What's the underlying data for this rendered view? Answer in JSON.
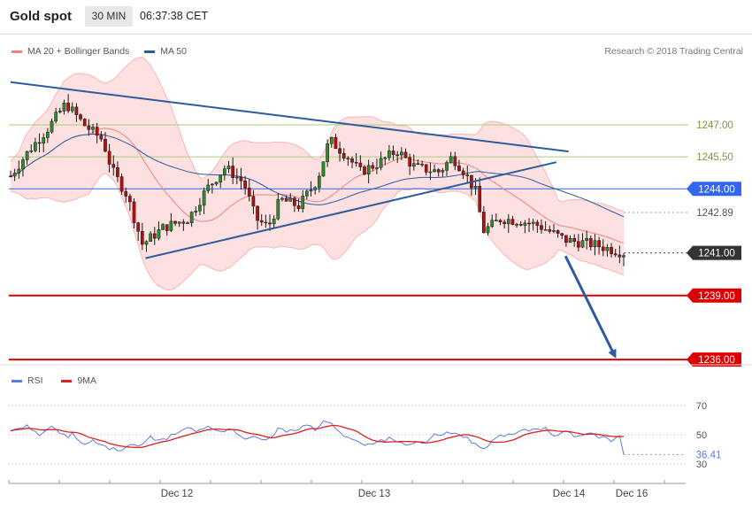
{
  "header": {
    "title": "Gold spot",
    "timeframe": "30 MIN",
    "time": "06:37:38 CET"
  },
  "legend": {
    "main": [
      {
        "label": "MA 20 + Bollinger Bands",
        "color": "#f08080"
      },
      {
        "label": "MA 50",
        "color": "#2e5a9e"
      }
    ],
    "rsi": [
      {
        "label": "RSI",
        "color": "#5b7be0"
      },
      {
        "label": "9MA",
        "color": "#e02020"
      }
    ]
  },
  "credit": "Research © 2018 Trading Central",
  "chart_data": [
    {
      "type": "candlestick",
      "ylim": [
        1235.5,
        1250.5
      ],
      "x_ticks": [
        "Dec 12",
        "Dec 13",
        "Dec 14",
        "Dec 16"
      ],
      "levels": [
        {
          "value": 1247.0,
          "label": "1247.00",
          "color": "#a8cf7a",
          "style": "solid"
        },
        {
          "value": 1245.5,
          "label": "1245.50",
          "color": "#a8cf7a",
          "style": "solid"
        },
        {
          "value": 1244.0,
          "label": "1244.00",
          "color": "#3366ee",
          "style": "solid",
          "tag_fill": "#3366ee"
        },
        {
          "value": 1242.89,
          "label": "1242.89",
          "color": "#8aa0d0",
          "style": "dotted"
        },
        {
          "value": 1241.0,
          "label": "1241.00",
          "color": "#444444",
          "style": "dotted",
          "tag_fill": "#333333"
        },
        {
          "value": 1239.0,
          "label": "1239.00",
          "color": "#dd0000",
          "style": "solid",
          "tag_fill": "#dd0000"
        },
        {
          "value": 1236.0,
          "label": "1236.00",
          "color": "#dd0000",
          "style": "solid",
          "tag_fill": "#dd0000"
        }
      ],
      "trendlines": [
        {
          "from": [
            0.0,
            1249.0
          ],
          "to": [
            0.91,
            1245.75
          ]
        },
        {
          "from": [
            0.22,
            1240.75
          ],
          "to": [
            0.89,
            1245.25
          ]
        }
      ],
      "projection": {
        "from": [
          0.905,
          1240.85
        ],
        "to": [
          0.985,
          1236.2
        ]
      },
      "series": [
        {
          "name": "MA 20 + Bollinger Bands"
        },
        {
          "name": "MA 50"
        }
      ]
    },
    {
      "type": "line",
      "title": "RSI",
      "ylim": [
        25,
        80
      ],
      "y_ticks": [
        30,
        50,
        70
      ],
      "current_value": "36.41",
      "series": [
        {
          "name": "RSI"
        },
        {
          "name": "9MA"
        }
      ]
    }
  ]
}
